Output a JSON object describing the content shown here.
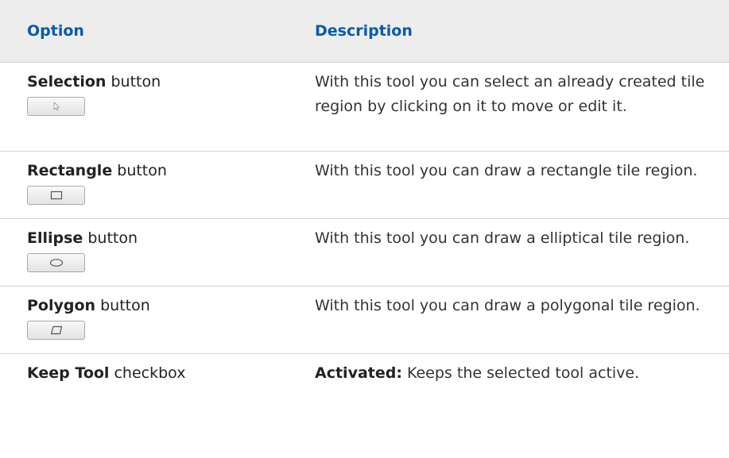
{
  "header": {
    "option": "Option",
    "description": "Description"
  },
  "rows": [
    {
      "name": "Selection",
      "suffix": " button",
      "icon": "pointer-arrow-icon",
      "description": "With this tool you can select an already created tile region by clicking on it to move or edit it."
    },
    {
      "name": "Rectangle",
      "suffix": " button",
      "icon": "rectangle-icon",
      "description": "With this tool you can draw a rectangle tile region."
    },
    {
      "name": "Ellipse",
      "suffix": " button",
      "icon": "ellipse-icon",
      "description": "With this tool you can draw a elliptical tile region."
    },
    {
      "name": "Polygon",
      "suffix": " button",
      "icon": "polygon-icon",
      "description": "With this tool you can draw a polygonal tile region."
    },
    {
      "name": "Keep Tool",
      "suffix": " checkbox",
      "description_label": "Activated:",
      "description": " Keeps the selected tool active."
    }
  ],
  "colors": {
    "header_bg": "#ededed",
    "header_text": "#0c5aa6",
    "divider": "#d4d4d4"
  }
}
